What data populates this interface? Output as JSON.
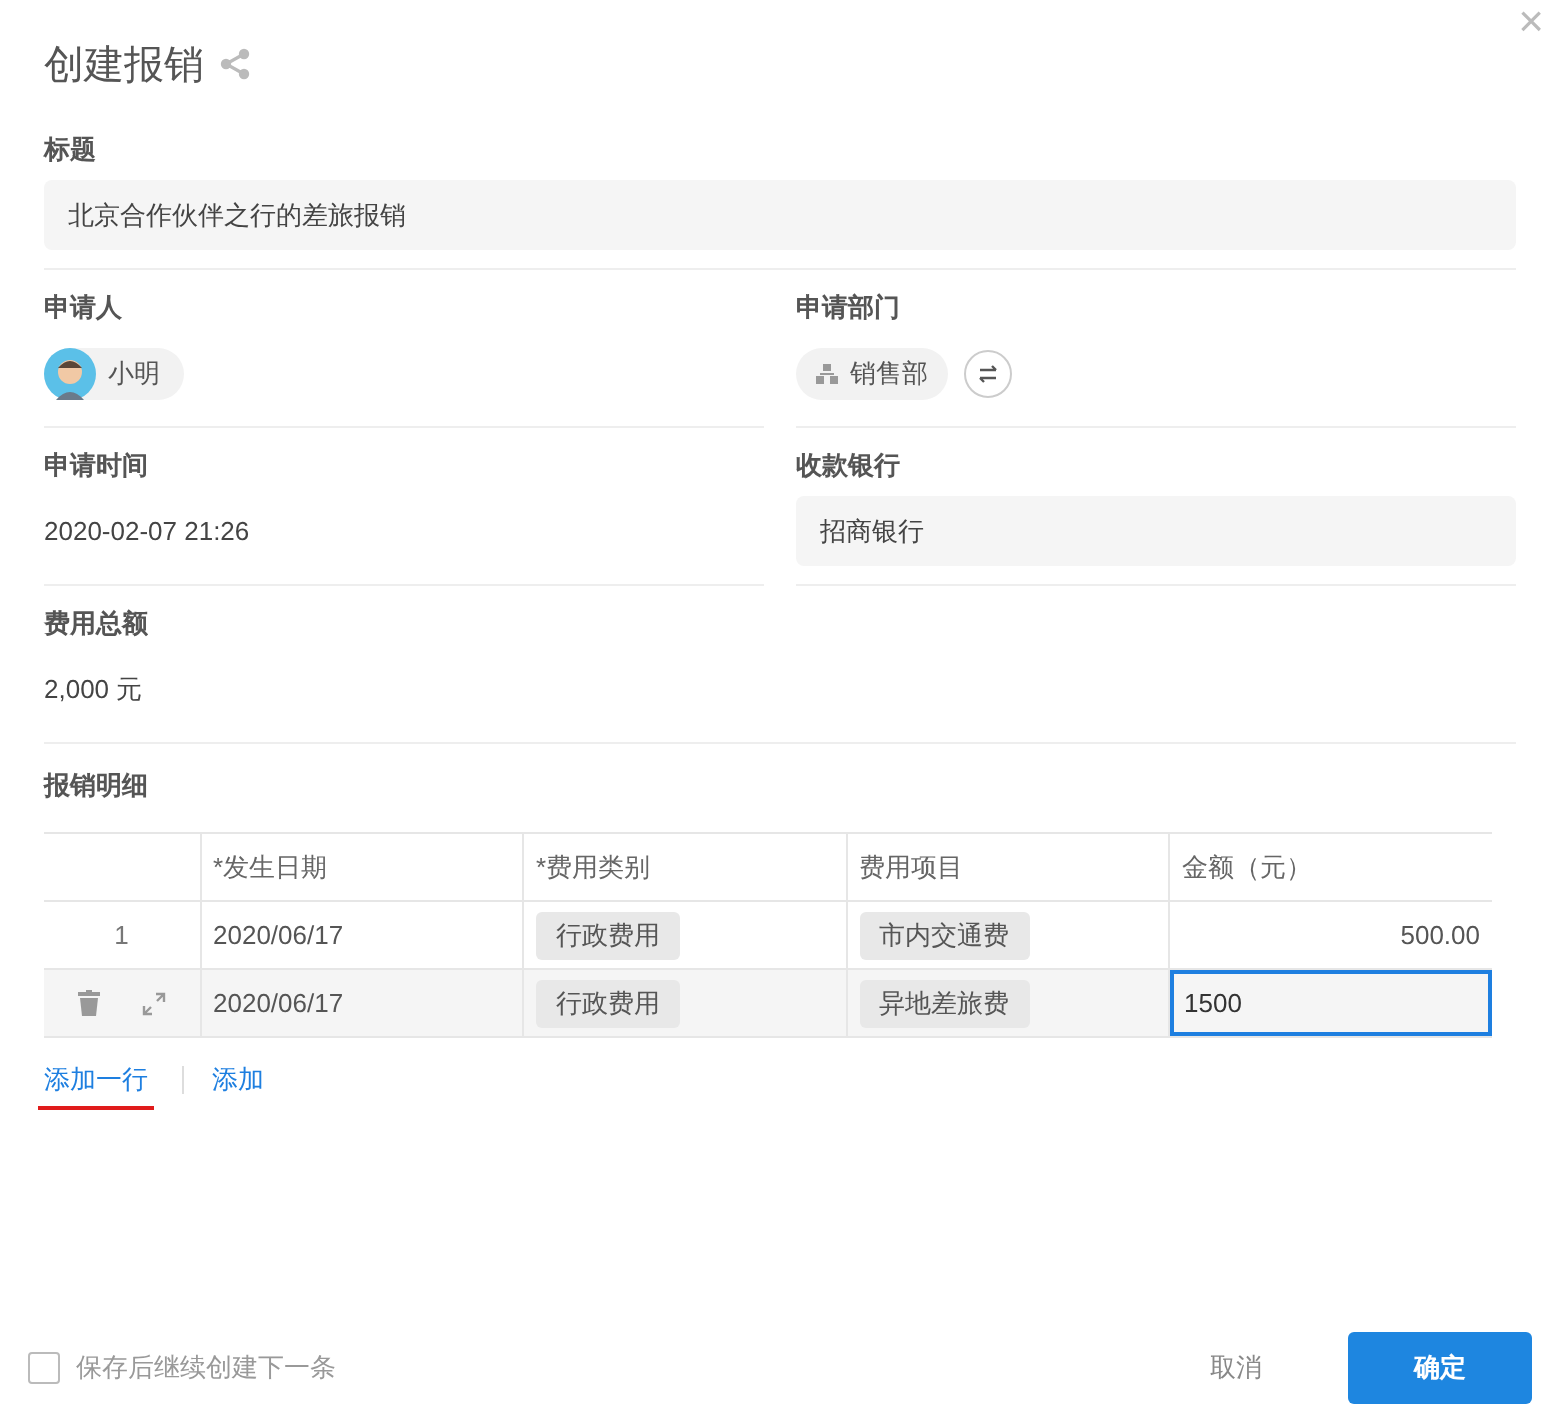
{
  "dialog": {
    "title": "创建报销",
    "close": "×"
  },
  "fields": [
    {
      "label": "标题",
      "kind": "input",
      "value": "北京合作伙伴之行的差旅报销",
      "span": true
    },
    {
      "label": "申请人",
      "kind": "person",
      "value": "小明",
      "span": false
    },
    {
      "label": "申请部门",
      "kind": "department",
      "value": "销售部",
      "span": false
    },
    {
      "label": "申请时间",
      "kind": "text",
      "value": "2020-02-07 21:26",
      "span": false
    },
    {
      "label": "收款银行",
      "kind": "input",
      "value": "招商银行",
      "span": false
    },
    {
      "label": "费用总额",
      "kind": "text",
      "value": "2,000 元",
      "span": true
    }
  ],
  "details": {
    "title": "报销明细",
    "columns": [
      "*发生日期",
      "*费用类别",
      "费用项目",
      "金额（元）"
    ],
    "rows": [
      {
        "index": "1",
        "hovered": false,
        "date": "2020/06/17",
        "category": "行政费用",
        "item": "市内交通费",
        "amount": "500.00",
        "editing": false
      },
      {
        "hovered": true,
        "date": "2020/06/17",
        "category": "行政费用",
        "item": "异地差旅费",
        "amount": "1500",
        "editing": true
      }
    ],
    "links": [
      {
        "label": "添加一行",
        "highlighted": true
      },
      {
        "label": "添加",
        "highlighted": false
      }
    ]
  },
  "footer": {
    "continue": {
      "label": "保存后继续创建下一条",
      "checked": false
    },
    "cancel": "取消",
    "confirm": "确定"
  }
}
